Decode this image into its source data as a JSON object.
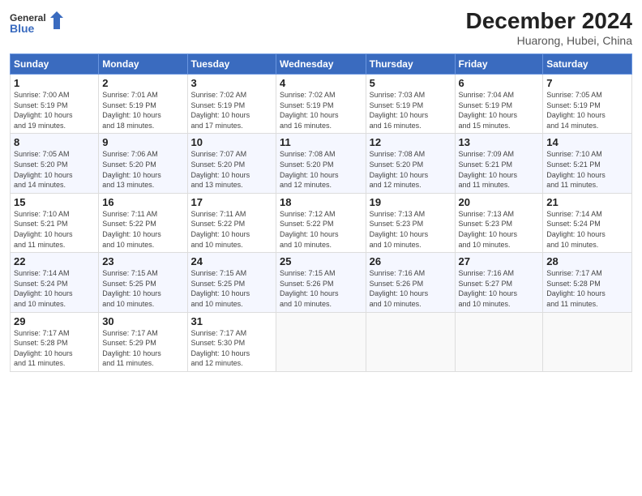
{
  "header": {
    "logo_line1": "General",
    "logo_line2": "Blue",
    "month": "December 2024",
    "location": "Huarong, Hubei, China"
  },
  "weekdays": [
    "Sunday",
    "Monday",
    "Tuesday",
    "Wednesday",
    "Thursday",
    "Friday",
    "Saturday"
  ],
  "weeks": [
    [
      {
        "day": "1",
        "info": "Sunrise: 7:00 AM\nSunset: 5:19 PM\nDaylight: 10 hours\nand 19 minutes."
      },
      {
        "day": "2",
        "info": "Sunrise: 7:01 AM\nSunset: 5:19 PM\nDaylight: 10 hours\nand 18 minutes."
      },
      {
        "day": "3",
        "info": "Sunrise: 7:02 AM\nSunset: 5:19 PM\nDaylight: 10 hours\nand 17 minutes."
      },
      {
        "day": "4",
        "info": "Sunrise: 7:02 AM\nSunset: 5:19 PM\nDaylight: 10 hours\nand 16 minutes."
      },
      {
        "day": "5",
        "info": "Sunrise: 7:03 AM\nSunset: 5:19 PM\nDaylight: 10 hours\nand 16 minutes."
      },
      {
        "day": "6",
        "info": "Sunrise: 7:04 AM\nSunset: 5:19 PM\nDaylight: 10 hours\nand 15 minutes."
      },
      {
        "day": "7",
        "info": "Sunrise: 7:05 AM\nSunset: 5:19 PM\nDaylight: 10 hours\nand 14 minutes."
      }
    ],
    [
      {
        "day": "8",
        "info": "Sunrise: 7:05 AM\nSunset: 5:20 PM\nDaylight: 10 hours\nand 14 minutes."
      },
      {
        "day": "9",
        "info": "Sunrise: 7:06 AM\nSunset: 5:20 PM\nDaylight: 10 hours\nand 13 minutes."
      },
      {
        "day": "10",
        "info": "Sunrise: 7:07 AM\nSunset: 5:20 PM\nDaylight: 10 hours\nand 13 minutes."
      },
      {
        "day": "11",
        "info": "Sunrise: 7:08 AM\nSunset: 5:20 PM\nDaylight: 10 hours\nand 12 minutes."
      },
      {
        "day": "12",
        "info": "Sunrise: 7:08 AM\nSunset: 5:20 PM\nDaylight: 10 hours\nand 12 minutes."
      },
      {
        "day": "13",
        "info": "Sunrise: 7:09 AM\nSunset: 5:21 PM\nDaylight: 10 hours\nand 11 minutes."
      },
      {
        "day": "14",
        "info": "Sunrise: 7:10 AM\nSunset: 5:21 PM\nDaylight: 10 hours\nand 11 minutes."
      }
    ],
    [
      {
        "day": "15",
        "info": "Sunrise: 7:10 AM\nSunset: 5:21 PM\nDaylight: 10 hours\nand 11 minutes."
      },
      {
        "day": "16",
        "info": "Sunrise: 7:11 AM\nSunset: 5:22 PM\nDaylight: 10 hours\nand 10 minutes."
      },
      {
        "day": "17",
        "info": "Sunrise: 7:11 AM\nSunset: 5:22 PM\nDaylight: 10 hours\nand 10 minutes."
      },
      {
        "day": "18",
        "info": "Sunrise: 7:12 AM\nSunset: 5:22 PM\nDaylight: 10 hours\nand 10 minutes."
      },
      {
        "day": "19",
        "info": "Sunrise: 7:13 AM\nSunset: 5:23 PM\nDaylight: 10 hours\nand 10 minutes."
      },
      {
        "day": "20",
        "info": "Sunrise: 7:13 AM\nSunset: 5:23 PM\nDaylight: 10 hours\nand 10 minutes."
      },
      {
        "day": "21",
        "info": "Sunrise: 7:14 AM\nSunset: 5:24 PM\nDaylight: 10 hours\nand 10 minutes."
      }
    ],
    [
      {
        "day": "22",
        "info": "Sunrise: 7:14 AM\nSunset: 5:24 PM\nDaylight: 10 hours\nand 10 minutes."
      },
      {
        "day": "23",
        "info": "Sunrise: 7:15 AM\nSunset: 5:25 PM\nDaylight: 10 hours\nand 10 minutes."
      },
      {
        "day": "24",
        "info": "Sunrise: 7:15 AM\nSunset: 5:25 PM\nDaylight: 10 hours\nand 10 minutes."
      },
      {
        "day": "25",
        "info": "Sunrise: 7:15 AM\nSunset: 5:26 PM\nDaylight: 10 hours\nand 10 minutes."
      },
      {
        "day": "26",
        "info": "Sunrise: 7:16 AM\nSunset: 5:26 PM\nDaylight: 10 hours\nand 10 minutes."
      },
      {
        "day": "27",
        "info": "Sunrise: 7:16 AM\nSunset: 5:27 PM\nDaylight: 10 hours\nand 10 minutes."
      },
      {
        "day": "28",
        "info": "Sunrise: 7:17 AM\nSunset: 5:28 PM\nDaylight: 10 hours\nand 11 minutes."
      }
    ],
    [
      {
        "day": "29",
        "info": "Sunrise: 7:17 AM\nSunset: 5:28 PM\nDaylight: 10 hours\nand 11 minutes."
      },
      {
        "day": "30",
        "info": "Sunrise: 7:17 AM\nSunset: 5:29 PM\nDaylight: 10 hours\nand 11 minutes."
      },
      {
        "day": "31",
        "info": "Sunrise: 7:17 AM\nSunset: 5:30 PM\nDaylight: 10 hours\nand 12 minutes."
      },
      {
        "day": "",
        "info": ""
      },
      {
        "day": "",
        "info": ""
      },
      {
        "day": "",
        "info": ""
      },
      {
        "day": "",
        "info": ""
      }
    ]
  ]
}
